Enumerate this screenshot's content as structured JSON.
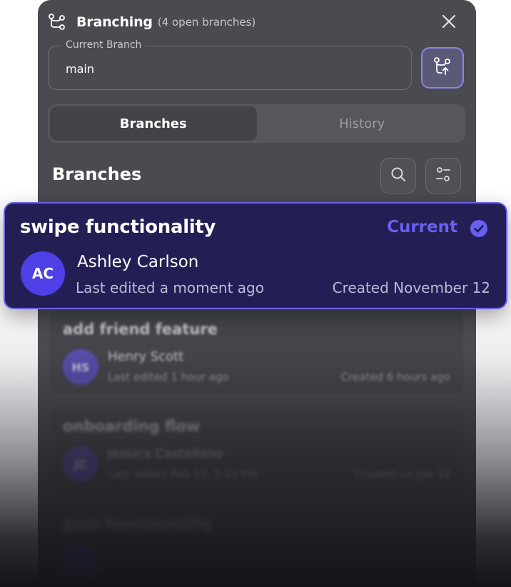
{
  "header": {
    "title": "Branching",
    "subtitle": "(4 open branches)"
  },
  "current_branch": {
    "label": "Current Branch",
    "value": "main"
  },
  "tabs": [
    {
      "label": "Branches",
      "active": true
    },
    {
      "label": "History",
      "active": false
    }
  ],
  "section": {
    "title": "Branches"
  },
  "branches": [
    {
      "name": "swipe functionality",
      "status": "Current",
      "user": "Ashley Carlson",
      "initials": "AC",
      "edited": "Last edited a moment ago",
      "created": "Created November 12"
    },
    {
      "name": "add friend feature",
      "user": "Henry Scott",
      "initials": "HS",
      "edited": "Last edited 1 hour ago",
      "created": "Created 6 hours ago"
    },
    {
      "name": "onboarding flow",
      "user": "Jessica Castellano",
      "initials": "JC",
      "edited": "Last edited Feb 10, 5:12 PM",
      "created": "Created on Jan 18"
    },
    {
      "name": "post functionality",
      "user": "",
      "initials": "",
      "edited": "",
      "created": ""
    }
  ],
  "icons": {
    "header": "branch-icon",
    "close": "close-icon",
    "switch": "switch-branch-icon",
    "search": "search-icon",
    "filter": "filter-icon",
    "current": "check-circle-icon"
  },
  "colors": {
    "accent": "#6a5ff0",
    "current_card_bg": "#231f55",
    "panel_bg": "#4a4b50"
  }
}
